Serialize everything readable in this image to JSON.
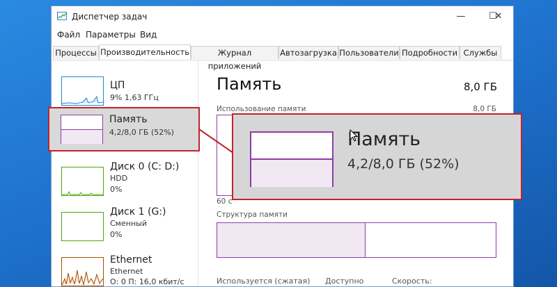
{
  "window": {
    "title": "Диспетчер задач",
    "controls": {
      "minimize": "—",
      "maximize": "☐",
      "close": "✕"
    }
  },
  "menu": [
    "Файл",
    "Параметры",
    "Вид"
  ],
  "tabs": [
    {
      "label": "Процессы"
    },
    {
      "label": "Производительность"
    },
    {
      "label": "Журнал приложений"
    },
    {
      "label": "Автозагрузка"
    },
    {
      "label": "Пользователи"
    },
    {
      "label": "Подробности"
    },
    {
      "label": "Службы"
    }
  ],
  "sidebar": {
    "items": [
      {
        "title": "ЦП",
        "sub1": "9% 1,63 ГГц",
        "sub2": ""
      },
      {
        "title": "Память",
        "sub1": "4,2/8,0 ГБ (52%)",
        "sub2": ""
      },
      {
        "title": "Диск 0 (C: D:)",
        "sub1": "HDD",
        "sub2": "0%"
      },
      {
        "title": "Диск 1 (G:)",
        "sub1": "Сменный",
        "sub2": "0%"
      },
      {
        "title": "Ethernet",
        "sub1": "Ethernet",
        "sub2": "О: 0 П: 16,0 кбит/с"
      }
    ]
  },
  "main": {
    "title": "Память",
    "total": "8,0 ГБ",
    "usage_label": "Использование памяти",
    "usage_max": "8,0 ГБ",
    "time_label": "60 с",
    "structure_label": "Структура памяти",
    "bottom": {
      "in_use": "Используется (сжатая)",
      "available": "Доступно",
      "speed": "Скорость:"
    }
  },
  "zoom": {
    "title": "Память",
    "sub": "4,2/8,0 ГБ (52%)"
  },
  "colors": {
    "accent_memory": "#8e3ba6",
    "accent_cpu": "#1c87c9",
    "accent_disk": "#4da60c",
    "accent_ethernet": "#a74f01",
    "highlight": "#c3222a"
  }
}
